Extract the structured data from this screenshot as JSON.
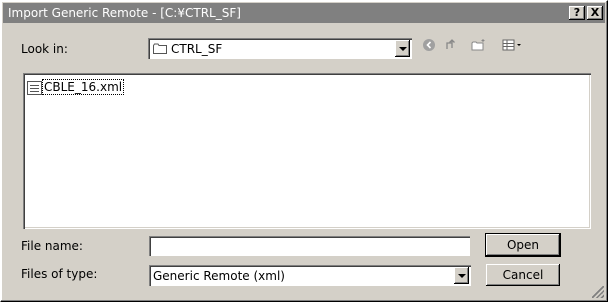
{
  "window": {
    "title": "Import Generic Remote - [C:¥CTRL_SF]",
    "help_label": "?",
    "close_label": "X"
  },
  "look_in": {
    "label": "Look in:",
    "value": "CTRL_SF"
  },
  "toolbar": {
    "icons": [
      "back-icon",
      "up-folder-icon",
      "new-folder-icon",
      "view-menu-icon"
    ]
  },
  "files": [
    {
      "name": "CBLE_16.xml",
      "icon": "xml-file-icon"
    }
  ],
  "file_name": {
    "label": "File name:",
    "value": ""
  },
  "files_of_type": {
    "label": "Files of type:",
    "value": "Generic Remote (xml)"
  },
  "buttons": {
    "open": "Open",
    "cancel": "Cancel"
  }
}
